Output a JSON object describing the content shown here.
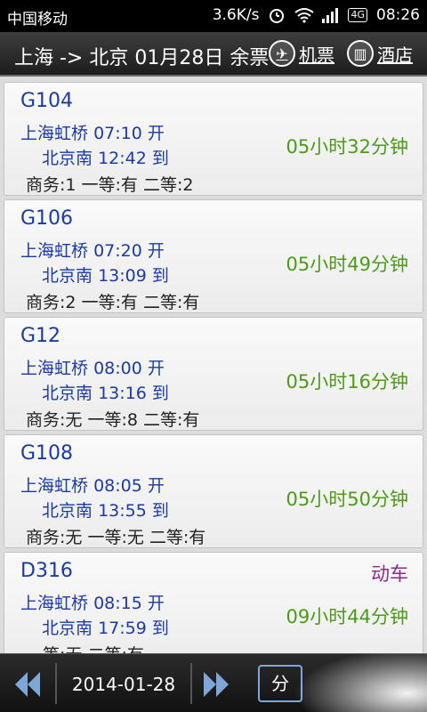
{
  "status": {
    "carrier": "中国移动",
    "speed": "3.6K/s",
    "network": "4G",
    "time": "08:26"
  },
  "header": {
    "route": "上海 -> 北京 01月28日 余票",
    "flight_label": "机票",
    "hotel_label": "酒店"
  },
  "trains": [
    {
      "no": "G104",
      "type": "",
      "dep_station": "上海虹桥",
      "dep_time": "07:10",
      "dep_word": "开",
      "arr_station": "北京南",
      "arr_time": "12:42",
      "arr_word": "到",
      "duration": "05小时32分钟",
      "seats": "商务:1 一等:有 二等:2"
    },
    {
      "no": "G106",
      "type": "",
      "dep_station": "上海虹桥",
      "dep_time": "07:20",
      "dep_word": "开",
      "arr_station": "北京南",
      "arr_time": "13:09",
      "arr_word": "到",
      "duration": "05小时49分钟",
      "seats": "商务:2 一等:有 二等:有"
    },
    {
      "no": "G12",
      "type": "",
      "dep_station": "上海虹桥",
      "dep_time": "08:00",
      "dep_word": "开",
      "arr_station": "北京南",
      "arr_time": "13:16",
      "arr_word": "到",
      "duration": "05小时16分钟",
      "seats": "商务:无 一等:8 二等:有"
    },
    {
      "no": "G108",
      "type": "",
      "dep_station": "上海虹桥",
      "dep_time": "08:05",
      "dep_word": "开",
      "arr_station": "北京南",
      "arr_time": "13:55",
      "arr_word": "到",
      "duration": "05小时50分钟",
      "seats": "商务:无 一等:无 二等:有"
    },
    {
      "no": "D316",
      "type": "动车",
      "dep_station": "上海虹桥",
      "dep_time": "08:15",
      "dep_word": "开",
      "arr_station": "北京南",
      "arr_time": "17:59",
      "arr_word": "到",
      "duration": "09小时44分钟",
      "seats": "一等:无 二等:有"
    }
  ],
  "footer": {
    "date": "2014-01-28",
    "sort_label": "分"
  }
}
